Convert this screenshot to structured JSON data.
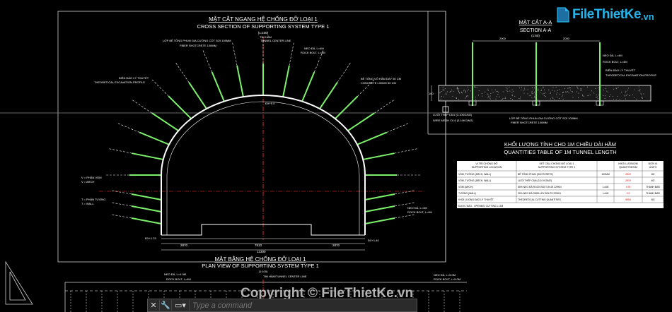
{
  "logo": {
    "text": "FileThietKe",
    "tld": ".vn"
  },
  "watermark": "Copyright © FileThietKe.vn",
  "cmdline": {
    "placeholder": "Type a command",
    "close": "✕",
    "wrench": "🔧",
    "prompt": "▭▾"
  },
  "cross_section": {
    "title_vn": "MẶT CẮT NGANG HỆ CHỐNG ĐỠ LOẠI 1",
    "title_en": "CROSS SECTION OF SUPPORTING SYSTEM TYPE 1",
    "scale": "(1:100)",
    "labels": {
      "tunnel_center": "TIM HẦM",
      "tunnel_center_en": "TUNNEL CENTER LINE",
      "lining": "LỚP BÊ TÔNG PHUN GIA CƯỜNG CỐT SỢI 100MM",
      "fiber": "FIBER SHOTCRETE 100MM",
      "rock_bolt_vn": "NEO ĐÁ, L=4M",
      "rock_bolt_en": "ROCK BOLT, L=4M",
      "concrete_vn": "BÊ TÔNG VỎ HẦM DÀY 50 CM",
      "concrete_en": "CONCRETE LINING 50 CM",
      "excavation_vn": "BIÊN ĐÀO LÝ THUYẾT",
      "excavation_en": "THEORETICAL EXCAVATION PROFILE",
      "arch_vn": "V = PHẦN VÒM",
      "arch_en": "V = ARCH",
      "wall_vn": "T = PHẦN TƯỜNG",
      "wall_en": "T = WALL",
      "width_total": "12300",
      "width_mid": "7810",
      "width_left": "2870",
      "width_right": "2870",
      "elev_left": "ĐX+1.23",
      "elev_right": "ĐX+1.40",
      "elev_top": "ĐX+9.0"
    }
  },
  "section_aa": {
    "title_vn": "MẶT CẮT A-A",
    "title_en": "SECTION A-A",
    "scale": "(1:50)",
    "dims": [
      "2000",
      "2000"
    ],
    "height": "100",
    "labels": {
      "rock_bolt_vn": "NEO ĐÁ, L=4M",
      "rock_bolt_en": "ROCK BOLT, L=4M",
      "excavation_vn": "BIÊN ĐÀO LÝ THUYẾT",
      "excavation_en": "THEORETICAL EXCAVATION PROFILE",
      "mesh_vn": "LƯỚI THÉP C6 6 (3.10KG/M2)",
      "mesh_en": "WIRE MESH C6 6 (3.10KG/M2)",
      "shotcrete_vn": "LỚP BÊ TÔNG PHUN GIA CƯỜNG CỐT SỢI 100MM",
      "shotcrete_en": "FIBER SHOTCRETE 100MM"
    }
  },
  "quantities": {
    "title_vn": "KHỐI LƯỢNG TÍNH CHO 1M CHIỀU DÀI HẦM",
    "title_en": "QUANTITIES TABLE OF 1M TUNNEL LENGTH",
    "headers": [
      "VỊ TRÍ CHỐNG ĐỠ\nSUPPORTING LOCATION",
      "KẾT CẤU CHỐNG ĐỠ LOẠI 1\nSUPPORTING SYSTEM TYPE 1",
      "",
      "KHỐI LƯỢNG/M\nQUANTITIES/M",
      "ĐƠN VỊ\nUNITS"
    ],
    "rows": [
      [
        "VÒM, TƯỜNG (ARCH, WALL)",
        "BÊ TÔNG PHUN (SHOTCRETE)",
        "100MM",
        "2519",
        "M2"
      ],
      [
        "VÒM, TƯỜNG (ARCH, WALL)",
        "LƯỚI THÉP C6/6 (3.10 KG/M2)",
        "",
        "2519",
        "M2"
      ],
      [
        "VÒM (ARCH)",
        "80% NEO ĐÁ ROCK BOLT Ø=25 229KN",
        "L=4M",
        "4.75",
        "THANH BAR"
      ],
      [
        "TƯỜNG (WALL)",
        "20% NEO ĐÁ SWELLEX BOLTS 229KN",
        "L=4M",
        "1.5",
        "THANH BAR"
      ],
      [
        "KHỐI LƯỢNG ĐÀO LÝ THUYẾT",
        "THEORETICAL CUTTING QUANTITIES",
        "",
        "5954",
        "M3"
      ]
    ],
    "footer": "ĐƯỢC ĐÀO - OPENING CUTTING L=2M"
  },
  "plan_view": {
    "title_vn": "MẶT BẰNG HỆ CHỐNG ĐỠ LOẠI 1",
    "title_en": "PLAN VIEW OF SUPPORTING SYSTEM TYPE 1",
    "scale": "(1:100)",
    "center": "TIM HẦM/TUNNEL CENTER LINE",
    "bolt_left_vn": "NEO ĐÁ, L=4.0M",
    "bolt_left_en": "ROCK BOLT, L=4M",
    "bolt_right_vn": "NEO ĐÁ, L=5.0M",
    "bolt_right_en": "ROCK BOLT, L=5.0M"
  },
  "colors": {
    "bg": "#000000",
    "line": "#ffffff",
    "bolt": "#7cf26b",
    "center": "#ff3333",
    "frame": "#cccccc",
    "accent": "#25b3e8"
  }
}
